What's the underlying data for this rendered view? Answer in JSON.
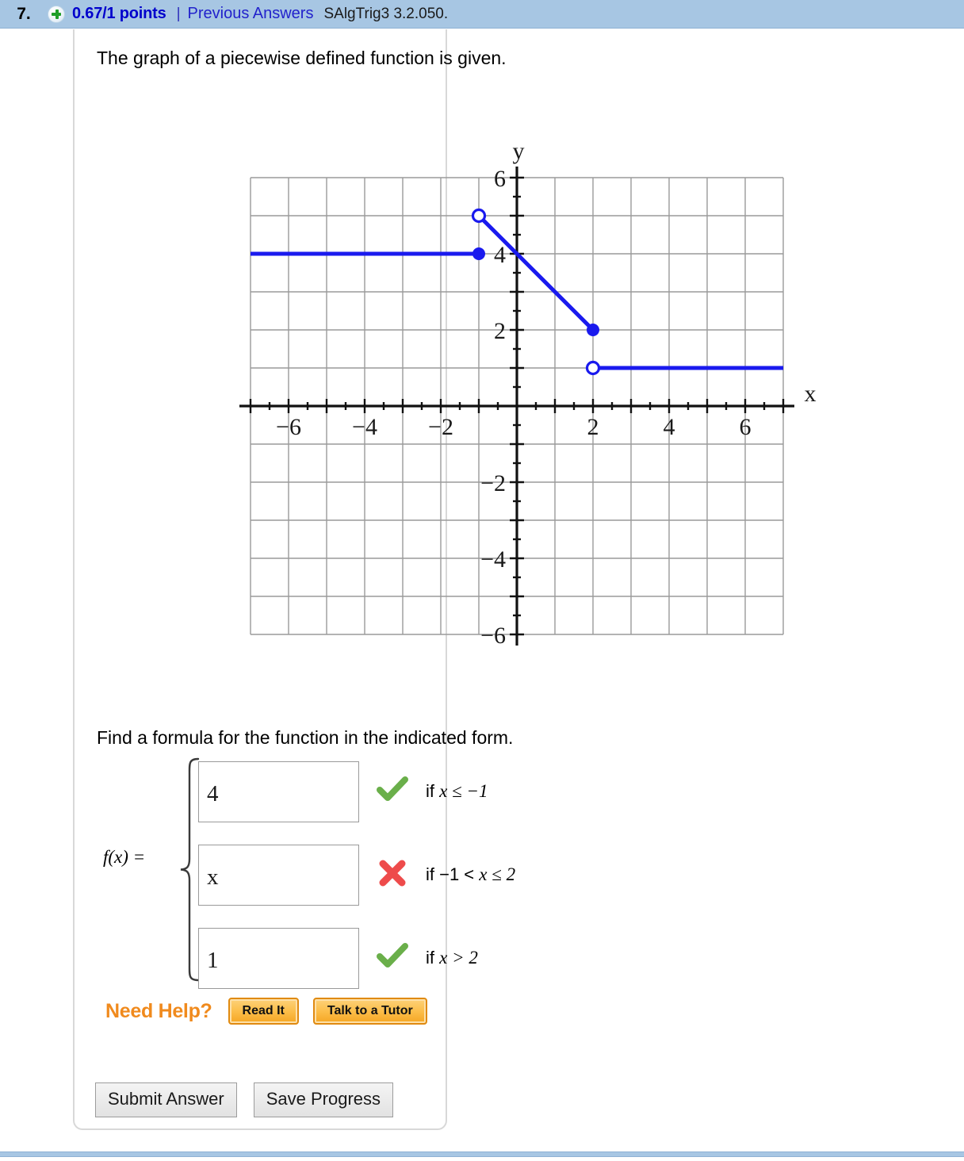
{
  "header": {
    "question_number": "7.",
    "plus_icon": "plus-circle-icon",
    "points": "0.67/1 points",
    "separator": "|",
    "previous_answers": "Previous Answers",
    "exercise_code": "SAlgTrig3 3.2.050."
  },
  "body": {
    "prompt": "The graph of a piecewise defined function is given.",
    "prompt2": "Find a formula for the function in the indicated form."
  },
  "chart_data": {
    "type": "line",
    "title": "",
    "xlabel": "x",
    "ylabel": "y",
    "xlim": [
      -7,
      7
    ],
    "ylim": [
      -6.6,
      6.6
    ],
    "grid": true,
    "xticks": [
      -6,
      -4,
      -2,
      2,
      4,
      6
    ],
    "yticks": [
      6,
      4,
      2,
      -2,
      -4,
      -6
    ],
    "xticklabels": [
      "−6",
      "−4",
      "−2",
      "2",
      "4",
      "6"
    ],
    "yticklabels": [
      "6",
      "4",
      "2",
      "−2",
      "−4",
      "−6"
    ],
    "minor_tick_step": 0.5,
    "grid_step": 1,
    "legend": "none",
    "line_color": "#1a1aee",
    "series": [
      {
        "name": "piece-1",
        "points": [
          [
            -7,
            4
          ],
          [
            -1,
            4
          ]
        ],
        "left_endpoint": "ray",
        "right_endpoint": "closed",
        "rule": "f(x) = 4 if x ≤ −1"
      },
      {
        "name": "piece-2",
        "points": [
          [
            -1,
            5
          ],
          [
            2,
            2
          ]
        ],
        "left_endpoint": "open",
        "right_endpoint": "closed",
        "rule": "f(x) = −x + 4 if −1 < x ≤ 2"
      },
      {
        "name": "piece-3",
        "points": [
          [
            2,
            1
          ],
          [
            7,
            1
          ]
        ],
        "left_endpoint": "open",
        "right_endpoint": "ray",
        "rule": "f(x) = 1 if x > 2"
      }
    ]
  },
  "answer": {
    "fx_label": "f(x) =",
    "pieces": [
      {
        "value": "4",
        "mark": "correct",
        "condition_prefix": "if ",
        "condition": "x ≤ −1"
      },
      {
        "value": "x",
        "mark": "incorrect",
        "condition_prefix": "if −1 < ",
        "condition": "x ≤ 2"
      },
      {
        "value": "1",
        "mark": "correct",
        "condition_prefix": "if ",
        "condition": "x > 2"
      }
    ],
    "placeholder": ""
  },
  "help": {
    "label": "Need Help?",
    "read_it": "Read It",
    "talk_to_tutor": "Talk to a Tutor"
  },
  "actions": {
    "submit": "Submit Answer",
    "save": "Save Progress"
  },
  "colors": {
    "header_bg": "#a7c6e3",
    "points_text": "#0000cc",
    "link": "#2222cc",
    "graph_line": "#1a1aee",
    "correct": "#6aaf4a",
    "incorrect": "#ee4b4b",
    "help_accent": "#f08a1d"
  }
}
